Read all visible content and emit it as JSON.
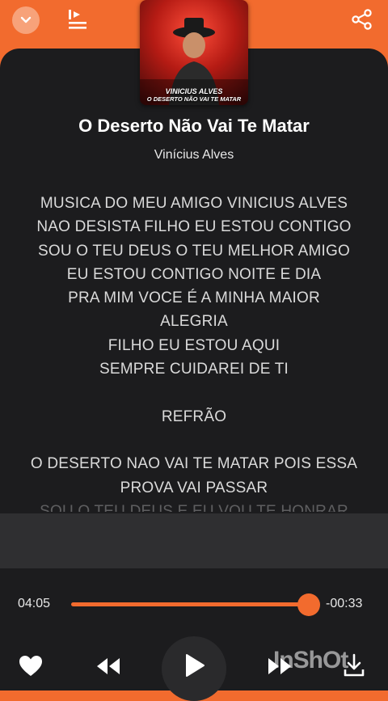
{
  "app": {
    "accent": "#f26b2e",
    "panel_color": "#1c1c1e"
  },
  "header": {
    "collapse_icon": "chevron-down-icon",
    "queue_icon": "play-queue-icon",
    "share_icon": "share-icon"
  },
  "cover": {
    "artist_caption": "VINICIUS ALVES",
    "title_caption": "O DESERTO NÃO VAI TE MATAR"
  },
  "track": {
    "title": "O Deserto Não Vai Te Matar",
    "artist": "Vinícius Alves"
  },
  "lyrics": [
    "MUSICA DO MEU AMIGO VINICIUS ALVES",
    "NAO DESISTA FILHO EU ESTOU CONTIGO",
    "SOU O TEU DEUS O TEU MELHOR AMIGO",
    "EU ESTOU CONTIGO NOITE E DIA",
    "PRA MIM VOCE É A MINHA MAIOR",
    "ALEGRIA",
    "FILHO EU ESTOU AQUI",
    "SEMPRE CUIDAREI DE TI",
    "",
    "REFRÃO",
    "",
    "O DESERTO NAO VAI TE MATAR POIS ESSA",
    "PROVA VAI PASSAR",
    "SOU O TEU DEUS E EU VOU TE HONRAR"
  ],
  "player": {
    "elapsed": "04:05",
    "remaining": "-00:33",
    "progress": 0.88,
    "like_icon": "heart-icon",
    "prev_icon": "rewind-icon",
    "play_icon": "play-icon",
    "next_icon": "fast-forward-icon",
    "download_icon": "download-icon"
  },
  "watermark": "InShOt"
}
